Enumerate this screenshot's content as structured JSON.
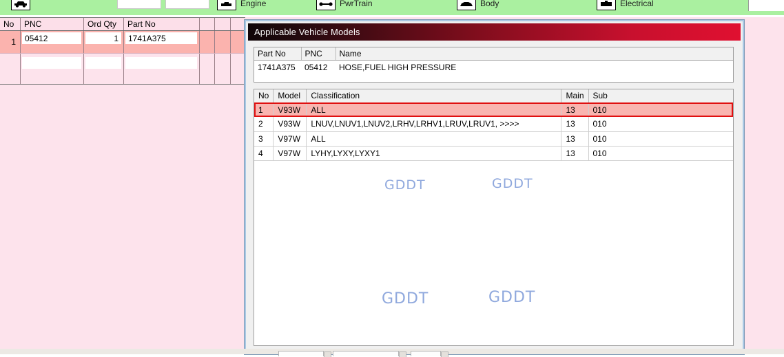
{
  "toolbar": {
    "items": [
      {
        "icon": "car-icon",
        "label": ""
      },
      {
        "icon": "engine-icon",
        "label": "Engine"
      },
      {
        "icon": "pwrtrain-icon",
        "label": "PwrTrain"
      },
      {
        "icon": "body-icon",
        "label": "Body"
      },
      {
        "icon": "electrical-icon",
        "label": "Electrical"
      }
    ],
    "field1_value": "",
    "field2_value": ""
  },
  "order_table": {
    "columns": [
      "No",
      "PNC",
      "Ord Qty",
      "Part No",
      "",
      "",
      ""
    ],
    "rows": [
      {
        "no": "1",
        "pnc": "05412",
        "ord_qty": "1",
        "part_no": "1741A375"
      },
      {
        "no": "",
        "pnc": "",
        "ord_qty": "",
        "part_no": ""
      }
    ]
  },
  "dialog": {
    "title": "Applicable Vehicle Models",
    "part_info": {
      "columns": [
        "Part No",
        "PNC",
        "Name"
      ],
      "row": {
        "part_no": "1741A375",
        "pnc": "05412",
        "name": "HOSE,FUEL HIGH PRESSURE"
      }
    },
    "models": {
      "columns": [
        "No",
        "Model",
        "Classification",
        "Main",
        "Sub"
      ],
      "rows": [
        {
          "no": "1",
          "model": "V93W",
          "classification": "ALL",
          "main": "13",
          "sub": "010",
          "selected": true
        },
        {
          "no": "2",
          "model": "V93W",
          "classification": "LNUV,LNUV1,LNUV2,LRHV,LRHV1,LRUV,LRUV1, >>>>",
          "main": "13",
          "sub": "010",
          "selected": false
        },
        {
          "no": "3",
          "model": "V97W",
          "classification": "ALL",
          "main": "13",
          "sub": "010",
          "selected": false
        },
        {
          "no": "4",
          "model": "V97W",
          "classification": "LYHY,LYXY,LYXY1",
          "main": "13",
          "sub": "010",
          "selected": false
        }
      ]
    }
  },
  "watermarks": {
    "text": "GDDT"
  },
  "colors": {
    "toolbar_green": "#aaf0a0",
    "page_pink": "#fde3ec",
    "selected_row_salmon": "#fbb3ae",
    "title_red": "#c8102e",
    "selection_outline": "#e01010",
    "dialog_border_blue": "#a9c8e4",
    "watermark_blue": "#8fa8dd"
  }
}
